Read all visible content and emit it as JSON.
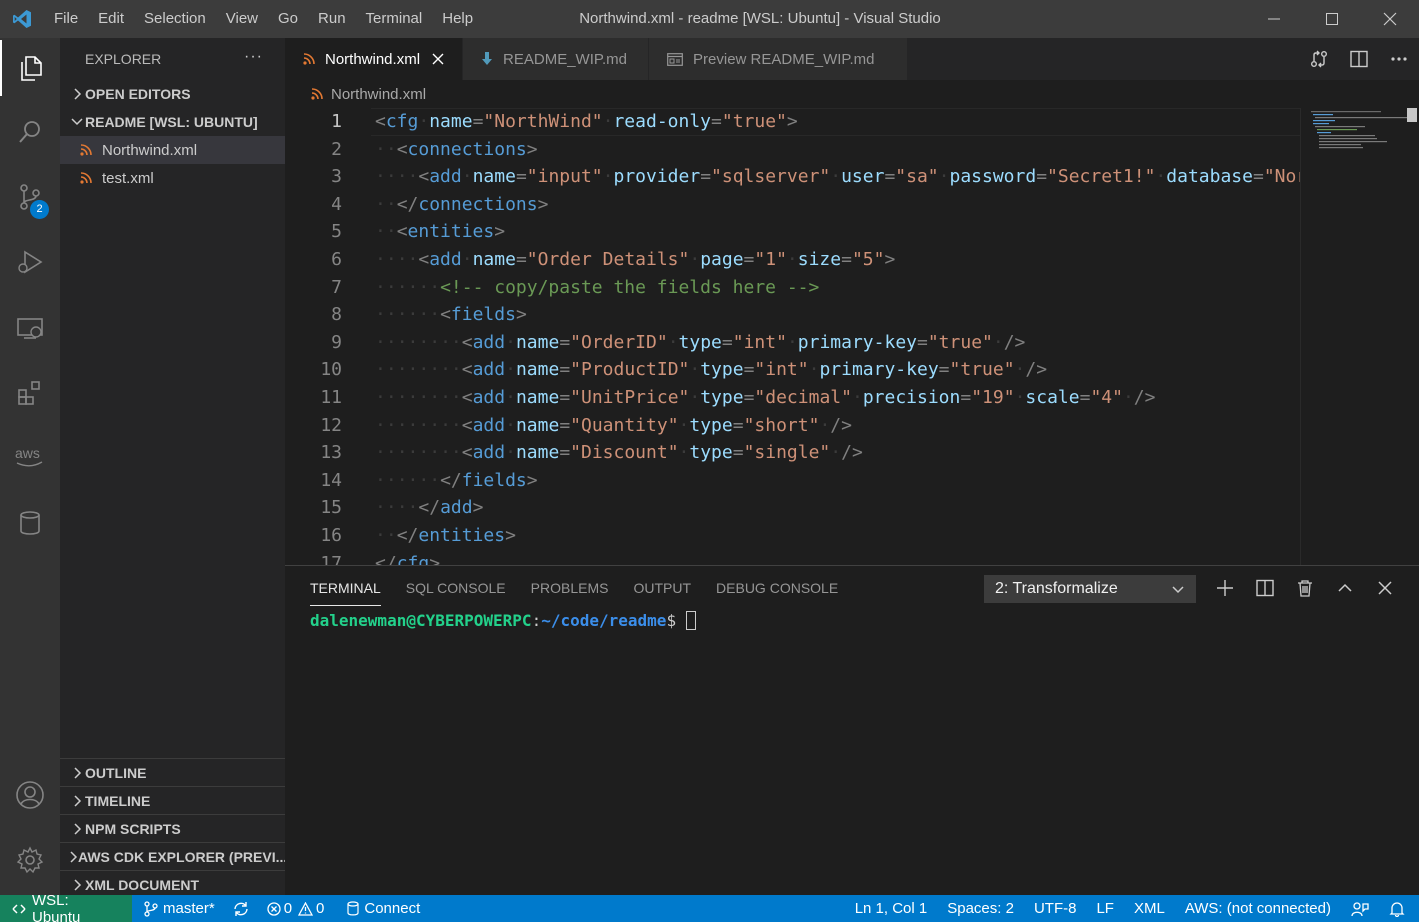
{
  "titlebar": {
    "menu": [
      "File",
      "Edit",
      "Selection",
      "View",
      "Go",
      "Run",
      "Terminal",
      "Help"
    ],
    "window_title": "Northwind.xml - readme [WSL: Ubuntu] - Visual Studio Code"
  },
  "activitybar": {
    "scm_badge": "2"
  },
  "sidebar": {
    "title": "EXPLORER",
    "more": "···",
    "open_editors": "OPEN EDITORS",
    "workspace": "README [WSL: UBUNTU]",
    "files": [
      "Northwind.xml",
      "test.xml"
    ],
    "sections": [
      "OUTLINE",
      "TIMELINE",
      "NPM SCRIPTS",
      "AWS CDK EXPLORER (PREVI...",
      "XML DOCUMENT"
    ]
  },
  "tabs": [
    {
      "label": "Northwind.xml",
      "icon": "rss-icon"
    },
    {
      "label": "README_WIP.md",
      "icon": "markdown-icon"
    },
    {
      "label": "Preview README_WIP.md",
      "icon": "preview-icon"
    }
  ],
  "breadcrumb": "Northwind.xml",
  "editor": {
    "line_numbers": [
      "1",
      "2",
      "3",
      "4",
      "5",
      "6",
      "7",
      "8",
      "9",
      "10",
      "11",
      "12",
      "13",
      "14",
      "15",
      "16",
      "17"
    ],
    "current_line": 1
  },
  "panel": {
    "tabs": [
      "TERMINAL",
      "SQL CONSOLE",
      "PROBLEMS",
      "OUTPUT",
      "DEBUG CONSOLE"
    ],
    "terminal_select": "2: Transformalize",
    "prompt_user": "dalenewman@CYBERPOWERPC",
    "prompt_sep": ":",
    "prompt_path": "~/code/readme",
    "prompt_symbol": "$ "
  },
  "statusbar": {
    "remote": "WSL: Ubuntu",
    "branch": "master*",
    "errors": "0",
    "warnings": "0",
    "connect": "Connect",
    "position": "Ln 1, Col 1",
    "spaces": "Spaces: 2",
    "encoding": "UTF-8",
    "eol": "LF",
    "language": "XML",
    "aws": "AWS: (not connected)"
  },
  "colors": {
    "accent": "#007acc",
    "remote": "#16825d",
    "xml_icon": "#e37933"
  }
}
